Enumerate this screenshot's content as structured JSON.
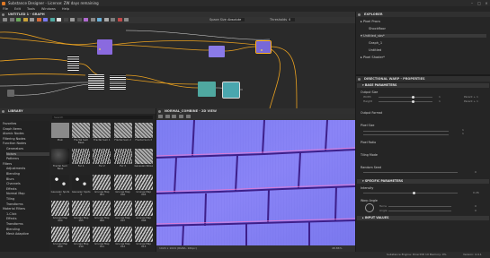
{
  "window": {
    "title": "Substance Designer - License: ZW days remaining"
  },
  "menu": [
    "File",
    "Edit",
    "Tools",
    "Windows",
    "Help"
  ],
  "graph": {
    "panel_title": "GRAPH",
    "tab": "Untitled 1",
    "view_label": "Space Size",
    "view_value": "Absolute",
    "threshold_label": "Thresholds",
    "threshold_value": "0"
  },
  "explorer": {
    "panel_title": "EXPLORER",
    "items": [
      "Pixel Procs",
      "Shockfloor",
      "Untitled_sbs*",
      "Graph_1",
      "Untitled",
      "Pixel Shader*"
    ]
  },
  "properties": {
    "panel_title": "Directional Warp - PROPERTIES",
    "sections": {
      "base": "BASE PARAMETERS",
      "specific": "SPECIFIC PARAMETERS",
      "input": "INPUT VALUES"
    },
    "output_size_label": "Output Size",
    "width_label": "Width",
    "height_label": "Height",
    "width_value": "1",
    "height_value": "1",
    "parent_label": "Parent + 1",
    "output_format_label": "Output Format",
    "pixel_size_label": "Pixel Size",
    "pixel_size_v": "1",
    "pixel_size_w": "1",
    "pixel_ratio_label": "Pixel Ratio",
    "tiling_mode_label": "Tiling Mode",
    "random_seed_label": "Random Seed",
    "random_seed_value": "0",
    "intensity_label": "Intensity",
    "intensity_value": "0.26",
    "warp_angle_label": "Warp Angle",
    "turns_label": "Turns",
    "turns_value": "0",
    "angle_label": "Angle",
    "angle_value": "0"
  },
  "library": {
    "panel_title": "LIBRARY",
    "search_placeholder": "Search",
    "categories": [
      "Favorites",
      "Graph Items",
      "Atomic Nodes",
      "Filtering Nodes",
      "Function Nodes",
      "Generators",
      "Noises",
      "Patterns",
      "Filters",
      "Adjustments",
      "Blending",
      "Blurs",
      "Channels",
      "Effects",
      "Normal Map",
      "Tiling",
      "Transforms",
      "Material Filters",
      "1-Click",
      "Effects",
      "Transforms",
      "Blending",
      "Mesh Adaptive"
    ],
    "tiles": [
      {
        "label": "Plain",
        "kind": "grey"
      },
      {
        "label": "Fractal Sum Base",
        "kind": "noise"
      },
      {
        "label": "Fractal Sum 1",
        "kind": "noise"
      },
      {
        "label": "Fractal Sum 2",
        "kind": "noise"
      },
      {
        "label": "Fractal Sum 3",
        "kind": "noise"
      },
      {
        "label": "Fractal Sum Base",
        "kind": "dark"
      },
      {
        "label": "Fur 1",
        "kind": "fur"
      },
      {
        "label": "Fur 2",
        "kind": "fur"
      },
      {
        "label": "Fur 3",
        "kind": "fur"
      },
      {
        "label": "Gaussian Noise",
        "kind": "noise"
      },
      {
        "label": "Gaussian Spots 1",
        "kind": "spots"
      },
      {
        "label": "Gaussian Spots 2",
        "kind": "spots"
      },
      {
        "label": "Grunge Map 001",
        "kind": "grunge"
      },
      {
        "label": "Grunge Map 002",
        "kind": "grunge"
      },
      {
        "label": "Grunge Map 003",
        "kind": "grunge"
      },
      {
        "label": "Grunge Map 004",
        "kind": "grunge"
      },
      {
        "label": "Grunge Map 005",
        "kind": "grunge"
      },
      {
        "label": "Grunge Map 006",
        "kind": "grunge"
      },
      {
        "label": "Grunge Map 007",
        "kind": "grunge"
      },
      {
        "label": "Grunge Map 008",
        "kind": "grunge"
      },
      {
        "label": "Grunge Map 009",
        "kind": "grunge"
      },
      {
        "label": "Grunge Map 010",
        "kind": "grunge"
      },
      {
        "label": "Grunge Map 011",
        "kind": "grunge"
      },
      {
        "label": "Grunge Map 012",
        "kind": "grunge"
      },
      {
        "label": "Grunge Map 013",
        "kind": "grunge"
      }
    ]
  },
  "view2d": {
    "panel_title": "Normal_combine - 2D VIEW",
    "zoom": "1024 x 1024 (RGBA, 16bpc)",
    "zoom_pct": "48.86%"
  },
  "statusbar": {
    "text": "Substance Engine: Direct3D 10   Memory: 0%",
    "version": "Version: 4.4.1"
  },
  "colors": {
    "accent": "#e07a26",
    "normal_base": "#7a7af0",
    "wire": "#e8a020",
    "node_purple": "#8a6adf",
    "node_teal": "#4fa8a0",
    "selected": "#ffb020"
  }
}
